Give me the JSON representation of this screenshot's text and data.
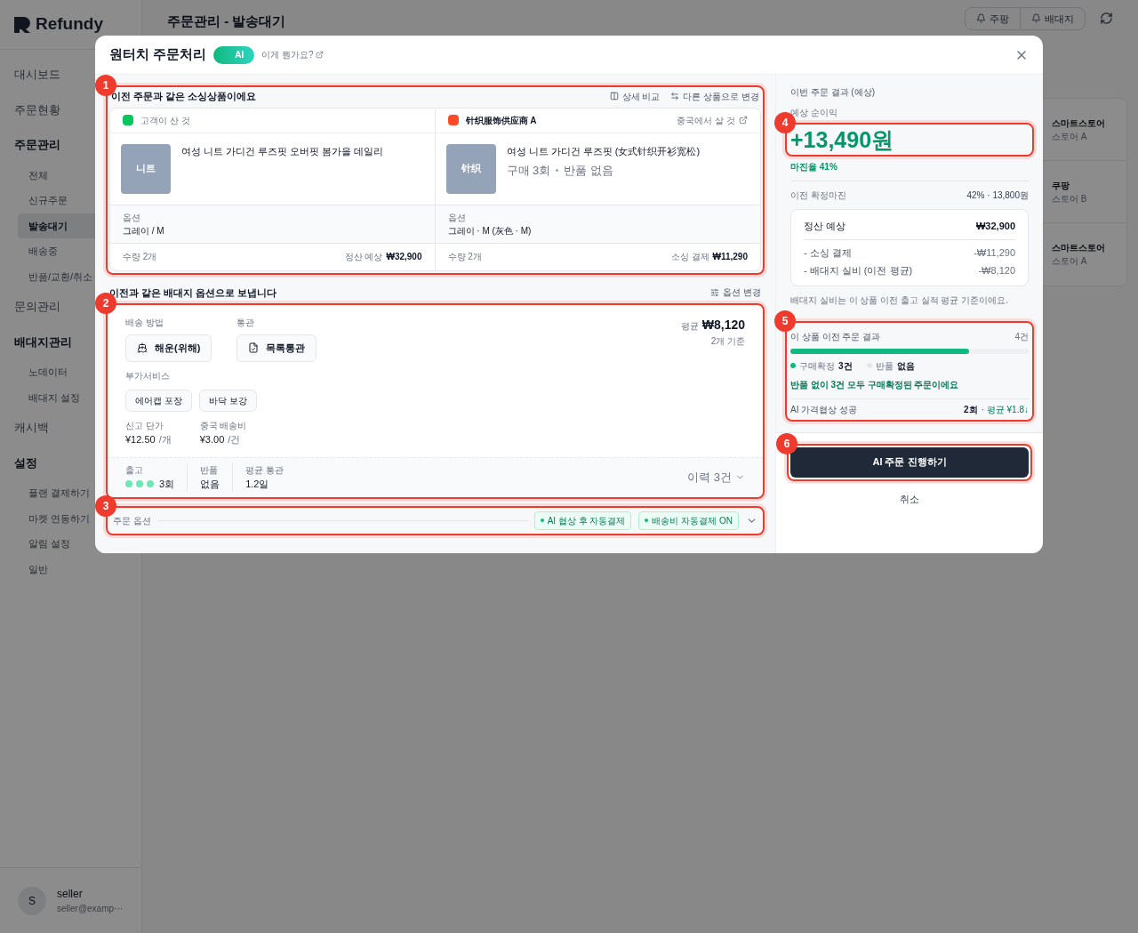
{
  "app": {
    "logo": "Refundy",
    "page_title": "주문관리 - 발송대기",
    "top_buttons": [
      "주팡",
      "배대지"
    ]
  },
  "sidebar": {
    "items": [
      {
        "label": "대시보드",
        "selected": false
      },
      {
        "label": "주문현황",
        "selected": false
      },
      {
        "label": "주문관리",
        "selected": false,
        "children": [
          {
            "label": "전체",
            "selected": false
          },
          {
            "label": "신규주문",
            "selected": false
          },
          {
            "label": "발송대기",
            "selected": true
          },
          {
            "label": "배송중",
            "selected": false
          },
          {
            "label": "반품/교환/취소",
            "selected": false
          }
        ]
      },
      {
        "label": "문의관리",
        "selected": false
      },
      {
        "label": "배대지관리",
        "selected": false,
        "children": [
          {
            "label": "노데이터",
            "selected": false
          },
          {
            "label": "배대지 설정",
            "selected": false
          }
        ]
      },
      {
        "label": "캐시백",
        "selected": false
      },
      {
        "label": "설정",
        "selected": false,
        "children": [
          {
            "label": "플랜 결제하기",
            "selected": false
          },
          {
            "label": "마켓 연동하기",
            "selected": false
          },
          {
            "label": "알림 설정",
            "selected": false
          },
          {
            "label": "일반",
            "selected": false
          }
        ]
      }
    ],
    "user": {
      "avatar": "S",
      "name": "seller",
      "email": "seller@examp···"
    }
  },
  "background_list": [
    {
      "market": "스마트스토어",
      "store": "스토어 A"
    },
    {
      "market": "쿠팡",
      "store": "스토어 B"
    },
    {
      "market": "스마트스토어",
      "store": "스토어 A"
    }
  ],
  "modal": {
    "title": "원터치 주문처리",
    "ai_toggle": {
      "label": "AI",
      "on": true
    },
    "help_link": "이게 뭔가요?",
    "sourcing": {
      "callout": "1",
      "title": "이전 주문과 같은 소싱상품이에요",
      "actions": [
        "상세 비교",
        "다른 상품으로 변경"
      ],
      "customer": {
        "label": "고객이 산 것",
        "thumb": "니트",
        "name": "여성 니트 가디건 루즈핏 오버핏 봄가을 데일리",
        "option_label": "옵션",
        "option": "그레이 / M",
        "qty": "수량 2개",
        "amount_label": "정산 예상",
        "amount": "₩32,900"
      },
      "supplier": {
        "vendor": "针织服饰供应商 A",
        "link": "중국에서 살 것",
        "thumb": "针织",
        "name": "여성 니트 가디건 루즈핏 (女式针织开衫宽松)",
        "purchases": "구매 3회",
        "returns": "반품 없음",
        "option_label": "옵션",
        "option": "그레이 · M (灰色 · M)",
        "qty": "수량 2개",
        "amount_label": "소싱 결제",
        "amount": "₩11,290"
      }
    },
    "forwarding": {
      "callout": "2",
      "title": "이전과 같은 배대지 옵션으로 보냅니다",
      "action": "옵션 변경",
      "method_label": "배송 방법",
      "method": "해운(위해)",
      "customs_label": "통관",
      "customs": "목록통관",
      "avg_label": "평균",
      "avg": "₩8,120",
      "avg_note": "2개 기준",
      "extras_label": "부가서비스",
      "extras": [
        "에어캡 포장",
        "바닥 보강"
      ],
      "declared_label": "신고 단가",
      "declared": "¥12.50",
      "declared_unit": "/개",
      "china_label": "중국 배송비",
      "china": "¥3.00",
      "china_unit": "/건",
      "stats": [
        {
          "label": "출고",
          "value": "3회",
          "kind": "dots"
        },
        {
          "label": "반품",
          "value": "없음",
          "kind": "plain"
        },
        {
          "label": "평균 통관",
          "value": "1.2일",
          "kind": "plain"
        }
      ],
      "history": "이력 3건"
    },
    "order_options": {
      "callout": "3",
      "label": "주문 옵션",
      "tags": [
        "AI 협상 후 자동결제",
        "배송비 자동결제 ON"
      ]
    },
    "result": {
      "title": "이번 주문 결과 (예상)",
      "profit_label": "예상 순이익",
      "profit": "+13,490원",
      "callout": "4",
      "margin": "마진율 41%",
      "prev_label": "이전 확정마진",
      "prev_value": "42% · 13,800원",
      "breakdown": [
        {
          "label": "정산 예상",
          "value": "₩32,900",
          "kind": "total"
        },
        {
          "label": "- 소싱 결제",
          "value": "-₩11,290",
          "kind": "deduction"
        },
        {
          "label": "- 배대지 실비 (이전 평균)",
          "value": "-₩8,120",
          "kind": "deduction"
        }
      ],
      "note": "배대지 실비는 이 상품 이전 출고 실적 평균 기준이에요.",
      "history": {
        "callout": "5",
        "title": "이 상품 이전 주문 결과",
        "count": "4건",
        "level": 0.75,
        "legend": [
          {
            "label": "구매확정",
            "value": "3건",
            "color": "#10b981"
          },
          {
            "label": "반품",
            "value": "없음",
            "color": "#e5e7eb"
          }
        ],
        "message": "반품 없이 3건 모두 구매확정된 주문이에요",
        "ai_label": "AI 가격협상 성공",
        "ai_count": "2회",
        "ai_avg": "· 평균 ¥1.8↓"
      }
    },
    "primary_button": {
      "label": "AI 주문 진행하기",
      "callout": "6"
    },
    "cancel": "취소"
  }
}
